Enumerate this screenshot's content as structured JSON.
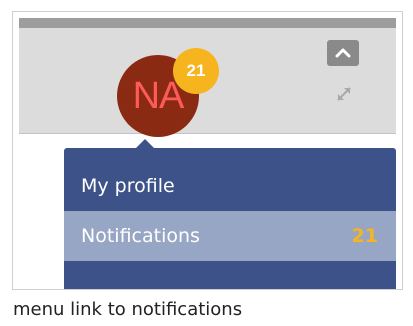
{
  "header": {
    "avatar_initials": "NA",
    "notification_badge": "21",
    "collapse_icon": "chevron-up-icon",
    "expand_icon": "expand-arrows-icon"
  },
  "menu": {
    "items": [
      {
        "label": "My profile",
        "count": ""
      },
      {
        "label": "Notifications",
        "count": "21"
      }
    ]
  },
  "caption": "menu link to notifications",
  "colors": {
    "menu_bg": "#3e528a",
    "menu_item_active_bg": "#97a6c4",
    "badge": "#f6b51f",
    "avatar_bg": "#8b2a12",
    "avatar_text": "#ff5a5a"
  }
}
